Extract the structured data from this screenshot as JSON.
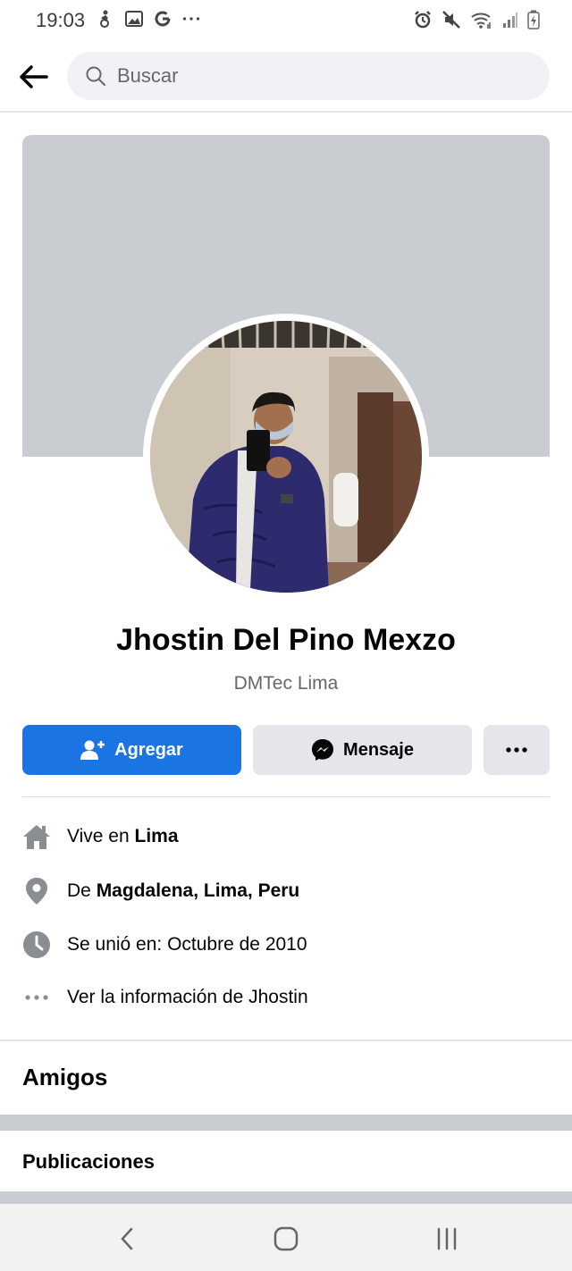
{
  "status_bar": {
    "time": "19:03",
    "left_icons": [
      "accessibility-icon",
      "gallery-icon",
      "google-icon",
      "more-dots-icon"
    ],
    "right_icons": [
      "alarm-icon",
      "mute-icon",
      "wifi-icon",
      "signal-icon",
      "battery-icon"
    ]
  },
  "header": {
    "search_placeholder": "Buscar"
  },
  "profile": {
    "name": "Jhostin Del Pino Mexzo",
    "work": "DMTec Lima"
  },
  "actions": {
    "add_label": "Agregar",
    "message_label": "Mensaje",
    "more_label": "•••"
  },
  "info": {
    "lives_prefix": "Vive en ",
    "lives_place": "Lima",
    "from_prefix": "De ",
    "from_place": "Magdalena, Lima, Peru",
    "joined": "Se unió en: Octubre de 2010",
    "see_more": "Ver la información de Jhostin"
  },
  "sections": {
    "friends": "Amigos",
    "posts": "Publicaciones"
  },
  "colors": {
    "primary_blue": "#1b74e4",
    "cover_gray": "#c9ccd1",
    "secondary_button": "#e4e6eb"
  }
}
